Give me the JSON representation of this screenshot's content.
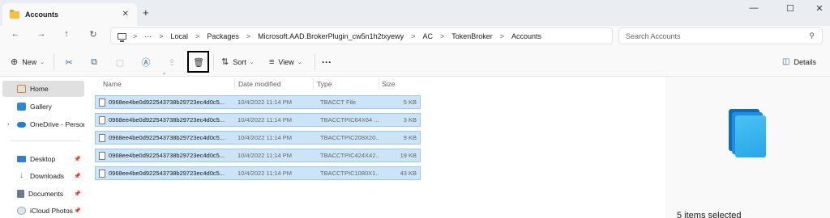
{
  "window": {
    "tab_title": "Accounts",
    "tab_close": "✕",
    "new_tab": "+",
    "minimize": "—",
    "maximize": "☐",
    "close": "✕"
  },
  "nav": {
    "back": "←",
    "forward": "→",
    "up": "↑",
    "refresh": "↻"
  },
  "address": {
    "more": "···",
    "breadcrumbs": [
      "Local",
      "Packages",
      "Microsoft.AAD.BrokerPlugin_cw5n1h2txyewy",
      "AC",
      "TokenBroker",
      "Accounts"
    ],
    "separator": ">"
  },
  "search": {
    "placeholder": "Search Accounts"
  },
  "toolbar": {
    "new_label": "New",
    "sort_label": "Sort",
    "view_label": "View",
    "more_label": "···",
    "details_label": "Details"
  },
  "sidebar": {
    "items": [
      {
        "label": "Home"
      },
      {
        "label": "Gallery"
      },
      {
        "label": "OneDrive - Persona"
      },
      {
        "label": "Desktop"
      },
      {
        "label": "Downloads"
      },
      {
        "label": "Documents"
      },
      {
        "label": "iCloud Photos"
      }
    ]
  },
  "columns": {
    "name": "Name",
    "date": "Date modified",
    "type": "Type",
    "size": "Size"
  },
  "files": [
    {
      "name": "0968ee4be0d922543738b29723ec4d0c5...",
      "date": "10/4/2022 11:14 PM",
      "type": "TBACCT File",
      "size": "5 KB"
    },
    {
      "name": "0968ee4be0d922543738b29723ec4d0c5...",
      "date": "10/4/2022 11:14 PM",
      "type": "TBACCTPIC64X64 ...",
      "size": "3 KB"
    },
    {
      "name": "0968ee4be0d922543738b29723ec4d0c5...",
      "date": "10/4/2022 11:14 PM",
      "type": "TBACCTPIC208X20...",
      "size": "9 KB"
    },
    {
      "name": "0968ee4be0d922543738b29723ec4d0c5...",
      "date": "10/4/2022 11:14 PM",
      "type": "TBACCTPIC424X42...",
      "size": "19 KB"
    },
    {
      "name": "0968ee4be0d922543738b29723ec4d0c5...",
      "date": "10/4/2022 11:14 PM",
      "type": "TBACCTPIC1080X1...",
      "size": "43 KB"
    }
  ],
  "details": {
    "selection_text": "5 items selected"
  },
  "colors": {
    "selection_bg": "#cce4f7",
    "selection_border": "#99c9ef",
    "accent": "#0067c0",
    "highlight_box": "#000000"
  }
}
